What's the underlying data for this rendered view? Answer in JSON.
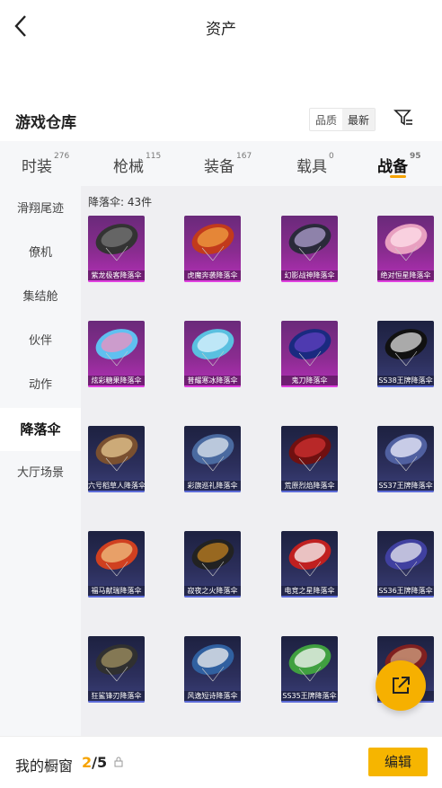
{
  "header": {
    "title": "资产"
  },
  "section": {
    "title": "游戏仓库",
    "sort_options": [
      "品质",
      "最新"
    ],
    "sort_selected": "最新"
  },
  "tabs": [
    {
      "label": "时装",
      "count": "276"
    },
    {
      "label": "枪械",
      "count": "115"
    },
    {
      "label": "装备",
      "count": "167"
    },
    {
      "label": "载具",
      "count": "0"
    },
    {
      "label": "战备",
      "count": "95"
    }
  ],
  "active_tab": "战备",
  "sidebar": {
    "items": [
      "滑翔尾迹",
      "僚机",
      "集结舱",
      "伙伴",
      "动作",
      "降落伞",
      "大厅场景"
    ],
    "active": "降落伞"
  },
  "content": {
    "count_label": "降落伞: 43件",
    "items": [
      {
        "name": "紫龙极客降落伞",
        "rarity": "purple"
      },
      {
        "name": "虎魔奔袭降落伞",
        "rarity": "purple"
      },
      {
        "name": "幻影战神降落伞",
        "rarity": "purple"
      },
      {
        "name": "绝对恒星降落伞",
        "rarity": "purple"
      },
      {
        "name": "炫彩糖果降落伞",
        "rarity": "purple"
      },
      {
        "name": "普耀寒冰降落伞",
        "rarity": "purple"
      },
      {
        "name": "鬼刀降落伞",
        "rarity": "purple"
      },
      {
        "name": "SS38王牌降落伞",
        "rarity": "blue"
      },
      {
        "name": "六号稻草人降落伞",
        "rarity": "blue"
      },
      {
        "name": "彩旗巡礼降落伞",
        "rarity": "blue"
      },
      {
        "name": "荒原烈焰降落伞",
        "rarity": "blue"
      },
      {
        "name": "SS37王牌降落伞",
        "rarity": "blue"
      },
      {
        "name": "福马献瑞降落伞",
        "rarity": "blue"
      },
      {
        "name": "寂夜之火降落伞",
        "rarity": "blue"
      },
      {
        "name": "电竞之星降落伞",
        "rarity": "blue"
      },
      {
        "name": "SS36王牌降落伞",
        "rarity": "blue"
      },
      {
        "name": "狂鲨锋刃降落伞",
        "rarity": "blue"
      },
      {
        "name": "风逸短诗降落伞",
        "rarity": "blue"
      },
      {
        "name": "SS35王牌降落伞",
        "rarity": "blue"
      },
      {
        "name": "",
        "rarity": "blue"
      }
    ]
  },
  "showcase": {
    "label": "我的橱窗",
    "current": "2",
    "total": "/5",
    "edit_label": "编辑"
  },
  "colors": {
    "accent": "#f6b000",
    "purple_card": "#8a2c90",
    "blue_card": "#2c2f5c"
  },
  "icons": [
    "back-arrow-icon",
    "filter-icon",
    "lock-icon",
    "share-icon"
  ]
}
